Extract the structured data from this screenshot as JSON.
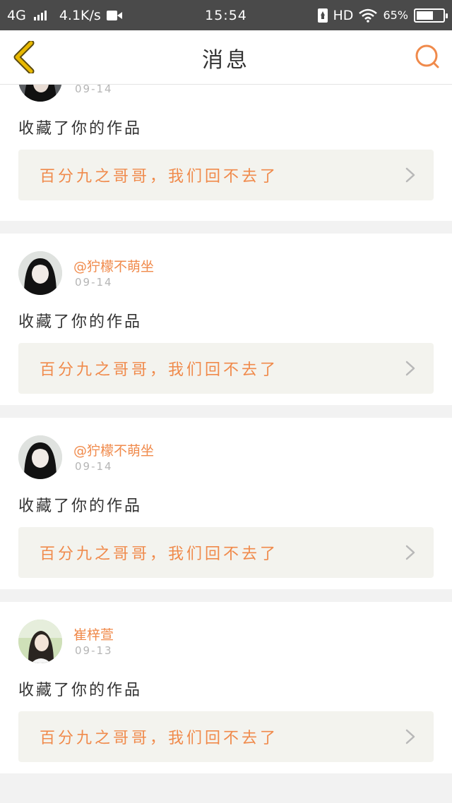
{
  "status_bar": {
    "network": "4G",
    "speed": "4.1K/s",
    "time": "15:54",
    "hd": "HD",
    "battery_percent": "65%",
    "battery_level": 0.65
  },
  "nav": {
    "title": "消息",
    "accent_color": "#f08a4b",
    "back_icon_color": "#e8b800"
  },
  "messages": [
    {
      "username": "",
      "date": "09-14",
      "action": "收藏了你的作品",
      "work_title": "百分九之哥哥，我们回不去了"
    },
    {
      "username": "@狞檬不萌坐",
      "date": "09-14",
      "action": "收藏了你的作品",
      "work_title": "百分九之哥哥，我们回不去了"
    },
    {
      "username": "@狞檬不萌坐",
      "date": "09-14",
      "action": "收藏了你的作品",
      "work_title": "百分九之哥哥，我们回不去了"
    },
    {
      "username": "崔梓萱",
      "date": "09-13",
      "action": "收藏了你的作品",
      "work_title": "百分九之哥哥，我们回不去了"
    }
  ]
}
